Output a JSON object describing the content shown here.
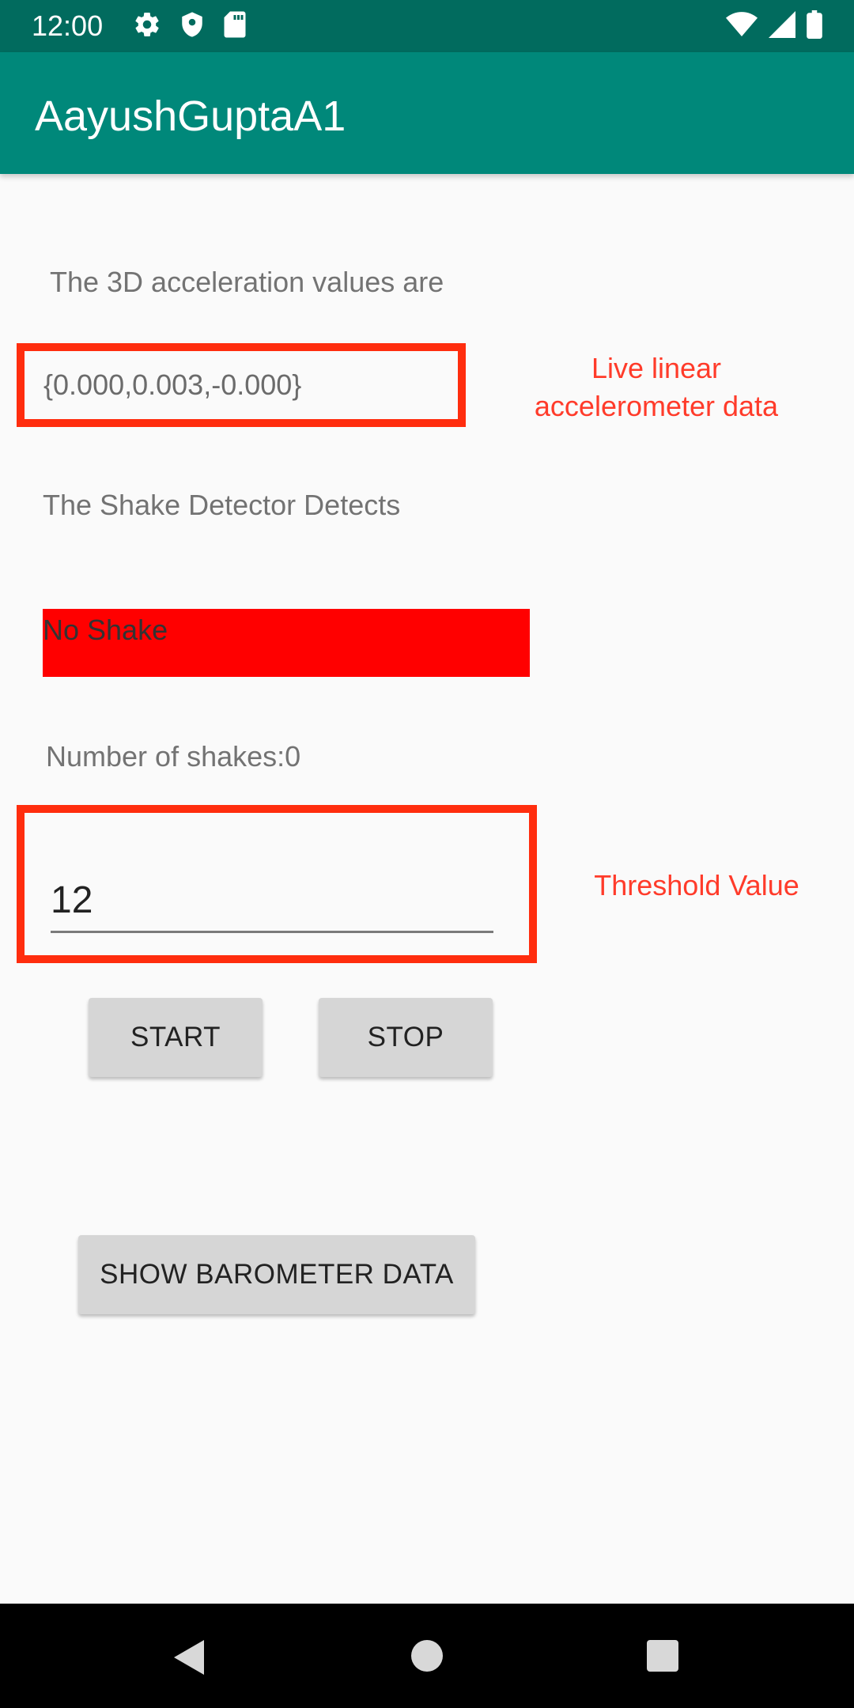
{
  "status_bar": {
    "time": "12:00",
    "icons_left": [
      "gear-icon",
      "shield-icon",
      "sd-card-icon"
    ],
    "icons_right": [
      "wifi-icon",
      "signal-icon",
      "battery-icon"
    ]
  },
  "app_bar": {
    "title": "AayushGuptaA1"
  },
  "main": {
    "accel_label": "The 3D acceleration values are",
    "accel_value": "{0.000,0.003,-0.000}",
    "shake_label": "The Shake Detector Detects",
    "shake_status": "No Shake",
    "shake_count": "Number of shakes:0",
    "threshold_value": "12",
    "start_label": "START",
    "stop_label": "STOP",
    "barometer_label": "SHOW BAROMETER DATA"
  },
  "annotations": {
    "live_data_line1": "Live linear",
    "live_data_line2": "accelerometer data",
    "threshold": "Threshold Value"
  },
  "colors": {
    "status_bar": "#016b5e",
    "app_bar": "#00887a",
    "shake_box": "#ff0000",
    "annotation": "#ff3b2a",
    "frame": "#ff2d0e"
  },
  "nav_bar": {
    "icons": [
      "back-icon",
      "home-icon",
      "recents-icon"
    ]
  }
}
